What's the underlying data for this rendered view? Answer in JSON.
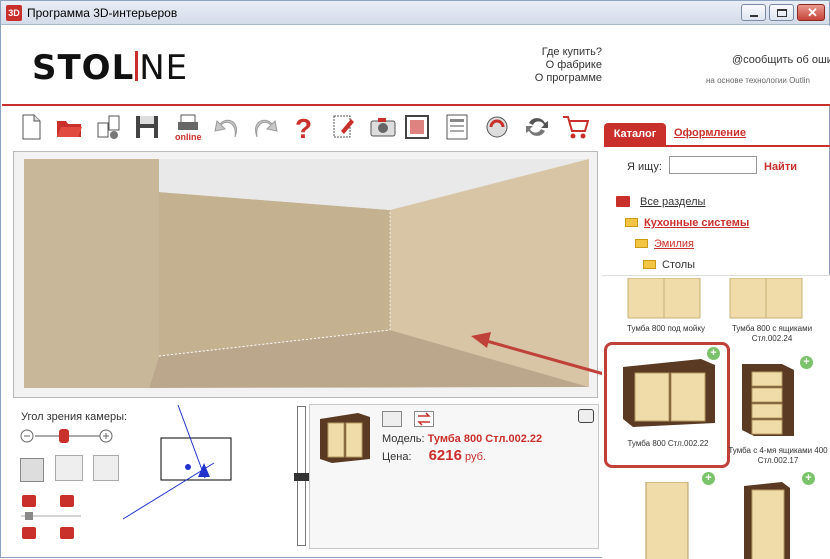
{
  "window": {
    "app_icon": "3D",
    "title": "Программа 3D-интерьеров"
  },
  "header": {
    "logo_bold": "STOL",
    "logo_thin": "NE",
    "links": [
      "Где купить?",
      "О фабрике",
      "О программе"
    ],
    "report": "@сообщить об оши",
    "tech": "на основе технологии Outlin"
  },
  "toolbar": {
    "online_label": "online",
    "icons": [
      "new-file-icon",
      "open-folder-icon",
      "share-icon",
      "save-icon",
      "online-print-icon",
      "undo-icon",
      "redo-icon",
      "help-icon",
      "edit-doc-icon",
      "camera-icon",
      "frame-icon",
      "report-icon",
      "refresh-icon",
      "rotate-icon",
      "cart-icon"
    ]
  },
  "camera": {
    "label": "Угол зрения камеры:"
  },
  "product": {
    "model_label": "Модель:",
    "model_value": "Тумба 800 Стл.002.22",
    "price_label": "Цена:",
    "price_value": "6216",
    "currency": "руб."
  },
  "catalog": {
    "tab_catalog": "Каталог",
    "tab_design": "Оформление",
    "search_label": "Я ищу:",
    "search_button": "Найти",
    "tree": [
      "Все разделы",
      "Кухонные системы",
      "Эмилия",
      "Столы"
    ],
    "items": [
      {
        "caption": "Тумба 800 под мойку"
      },
      {
        "caption": "Тумба 800 с ящиками Стл.002.24"
      },
      {
        "caption": "Тумба 800 Стл.002.22"
      },
      {
        "caption": "Тумба с 4-мя ящиками 400 Стл.002.17"
      }
    ]
  },
  "colors": {
    "accent": "#c9302c",
    "wall_left": "#c9b79a",
    "wall_back": "#c4b190",
    "wall_right": "#d8c5a6",
    "floor": "#baa78c",
    "cabinet_wood": "#5a3a22",
    "cabinet_door": "#f0dca8"
  }
}
